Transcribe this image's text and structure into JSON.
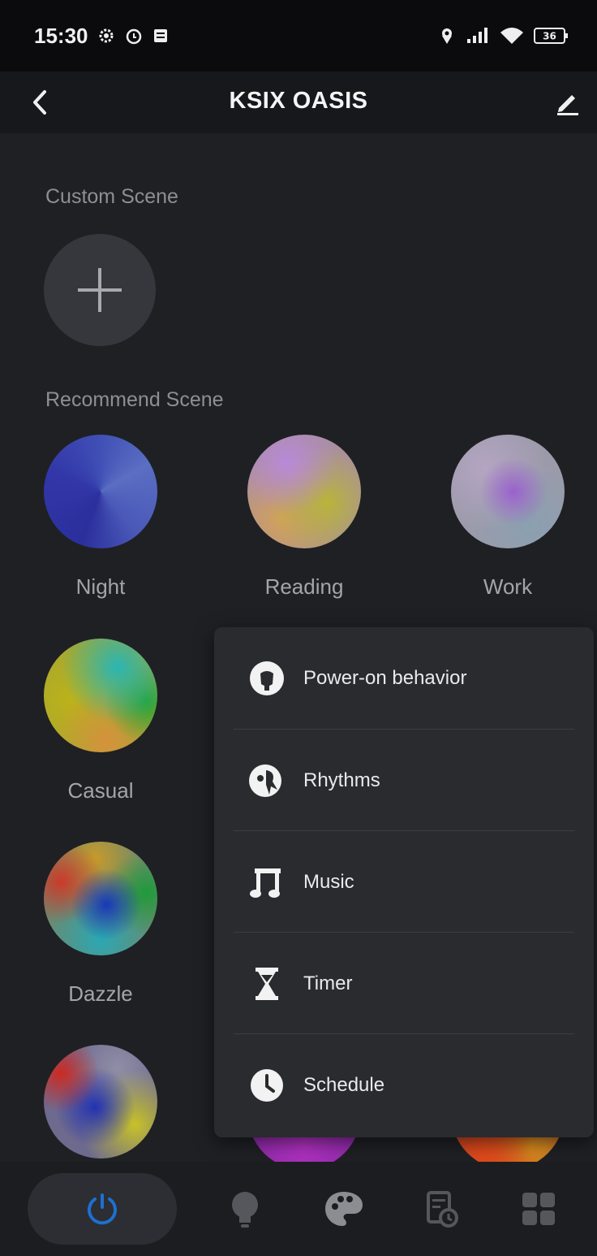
{
  "status_bar": {
    "time": "15:30",
    "icons": [
      "gear-icon",
      "alarm-icon",
      "notification-icon",
      "location-icon",
      "signal-icon",
      "wifi-icon",
      "battery-icon"
    ],
    "battery_level": "36"
  },
  "header": {
    "title": "KSIX OASIS",
    "back_icon": "chevron-left-icon",
    "edit_icon": "pencil-icon"
  },
  "custom_scene": {
    "label": "Custom Scene",
    "add_icon": "plus-icon"
  },
  "recommend_scene": {
    "label": "Recommend Scene",
    "scenes": [
      {
        "name": "Night"
      },
      {
        "name": "Reading"
      },
      {
        "name": "Work"
      },
      {
        "name": "Casual"
      },
      {
        "name": "Dazzle"
      }
    ]
  },
  "menu": {
    "items": [
      {
        "label": "Power-on behavior",
        "icon": "power-on-behavior-icon"
      },
      {
        "label": "Rhythms",
        "icon": "rhythms-icon"
      },
      {
        "label": "Music",
        "icon": "music-note-icon"
      },
      {
        "label": "Timer",
        "icon": "hourglass-icon"
      },
      {
        "label": "Schedule",
        "icon": "clock-icon"
      }
    ]
  },
  "bottom_nav": {
    "items": [
      "power-icon",
      "bulb-icon",
      "palette-icon",
      "schedule-list-icon",
      "grid-icon"
    ],
    "active": "power-icon"
  },
  "colors": {
    "background": "#1f2024",
    "menu_background": "#2a2b2f",
    "accent_blue": "#1e6fd0",
    "text_secondary": "#8d8f95"
  }
}
